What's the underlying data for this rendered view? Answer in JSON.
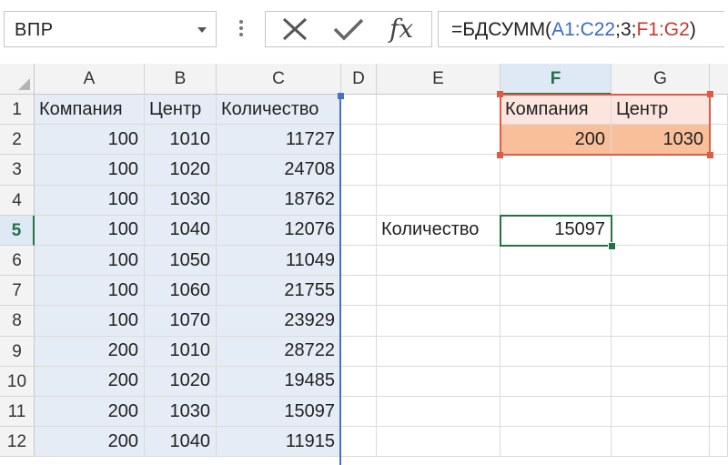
{
  "name_box": {
    "value": "ВПР"
  },
  "formula_bar": {
    "cancel_icon": "x-icon",
    "enter_icon": "check-icon",
    "function_label": "fx",
    "formula_parts": [
      {
        "text": "=БДСУММ(",
        "color": "default"
      },
      {
        "text": "A1:C22",
        "color": "blue"
      },
      {
        "text": ";3;",
        "color": "default"
      },
      {
        "text": "F1:G2",
        "color": "red"
      },
      {
        "text": ")",
        "color": "default"
      }
    ]
  },
  "columns": [
    "A",
    "B",
    "C",
    "D",
    "E",
    "F",
    "G"
  ],
  "active_column": "F",
  "rows": [
    "1",
    "2",
    "3",
    "4",
    "5",
    "6",
    "7",
    "8",
    "9",
    "10",
    "11",
    "12"
  ],
  "active_row": "5",
  "headers": {
    "A1": "Компания",
    "B1": "Центр",
    "C1": "Количество"
  },
  "data_rows": [
    [
      "100",
      "1010",
      "11727"
    ],
    [
      "100",
      "1020",
      "24708"
    ],
    [
      "100",
      "1030",
      "18762"
    ],
    [
      "100",
      "1040",
      "12076"
    ],
    [
      "100",
      "1050",
      "11049"
    ],
    [
      "100",
      "1060",
      "21755"
    ],
    [
      "100",
      "1070",
      "23929"
    ],
    [
      "200",
      "1010",
      "28722"
    ],
    [
      "200",
      "1020",
      "19485"
    ],
    [
      "200",
      "1030",
      "15097"
    ],
    [
      "200",
      "1040",
      "11915"
    ]
  ],
  "criteria": {
    "F1": "Компания",
    "G1": "Центр",
    "F2": "200",
    "G2": "1030"
  },
  "result": {
    "E5": "Количество",
    "F5": "15097"
  },
  "colors": {
    "accent_green": "#217346",
    "range_blue": "#4472c4",
    "range_red": "#e05a45",
    "criteria_value_fill": "#f8c09a",
    "criteria_header_fill": "#fbe5de",
    "selection_fill": "#e6ecf6"
  }
}
